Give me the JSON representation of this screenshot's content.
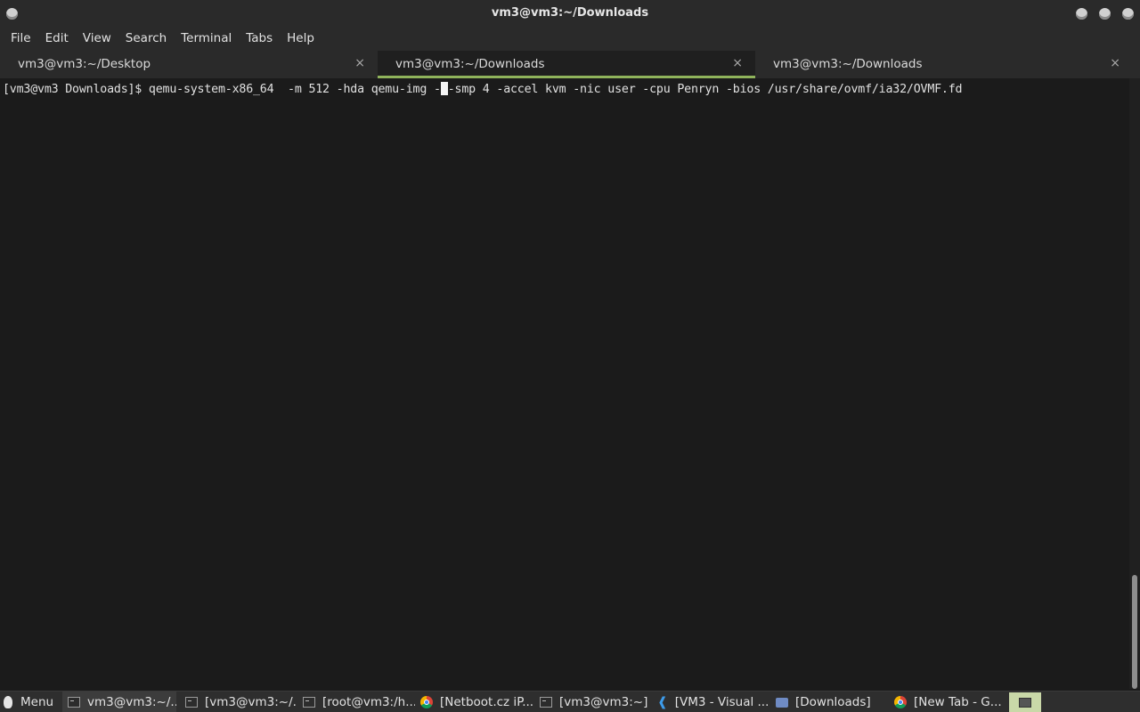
{
  "window": {
    "title": "vm3@vm3:~/Downloads"
  },
  "menubar": [
    "File",
    "Edit",
    "View",
    "Search",
    "Terminal",
    "Tabs",
    "Help"
  ],
  "tabs": [
    {
      "label": "vm3@vm3:~/Desktop",
      "close": "×",
      "active": false
    },
    {
      "label": "vm3@vm3:~/Downloads",
      "close": "×",
      "active": true
    },
    {
      "label": "vm3@vm3:~/Downloads",
      "close": "×",
      "active": false
    }
  ],
  "terminal": {
    "prompt": "[vm3@vm3 Downloads]$ ",
    "command_before_cursor": "qemu-system-x86_64  -m 512 -hda qemu-img -",
    "command_after_cursor": "-smp 4 -accel kvm -nic user -cpu Penryn -bios /usr/share/ovmf/ia32/OVMF.fd"
  },
  "taskbar": {
    "menu_label": "Menu",
    "items": [
      {
        "label": "vm3@vm3:~/...",
        "icon": "terminal-icon",
        "active": true
      },
      {
        "label": "[vm3@vm3:~/...",
        "icon": "terminal-icon",
        "active": false
      },
      {
        "label": "[root@vm3:/h...",
        "icon": "terminal-icon",
        "active": false
      },
      {
        "label": "[Netboot.cz iP...",
        "icon": "chrome-icon",
        "active": false
      },
      {
        "label": "[vm3@vm3:~]",
        "icon": "terminal-icon",
        "active": false
      },
      {
        "label": "[VM3 - Visual ...",
        "icon": "vscode-icon",
        "active": false
      },
      {
        "label": "[Downloads]",
        "icon": "folder-icon",
        "active": false
      },
      {
        "label": "[New Tab - G...",
        "icon": "chrome-icon",
        "active": false
      }
    ]
  },
  "colors": {
    "active_tab_underline": "#8fb35b",
    "terminal_bg": "#1b1b1b",
    "tray_highlight": "#c9d8a8"
  }
}
